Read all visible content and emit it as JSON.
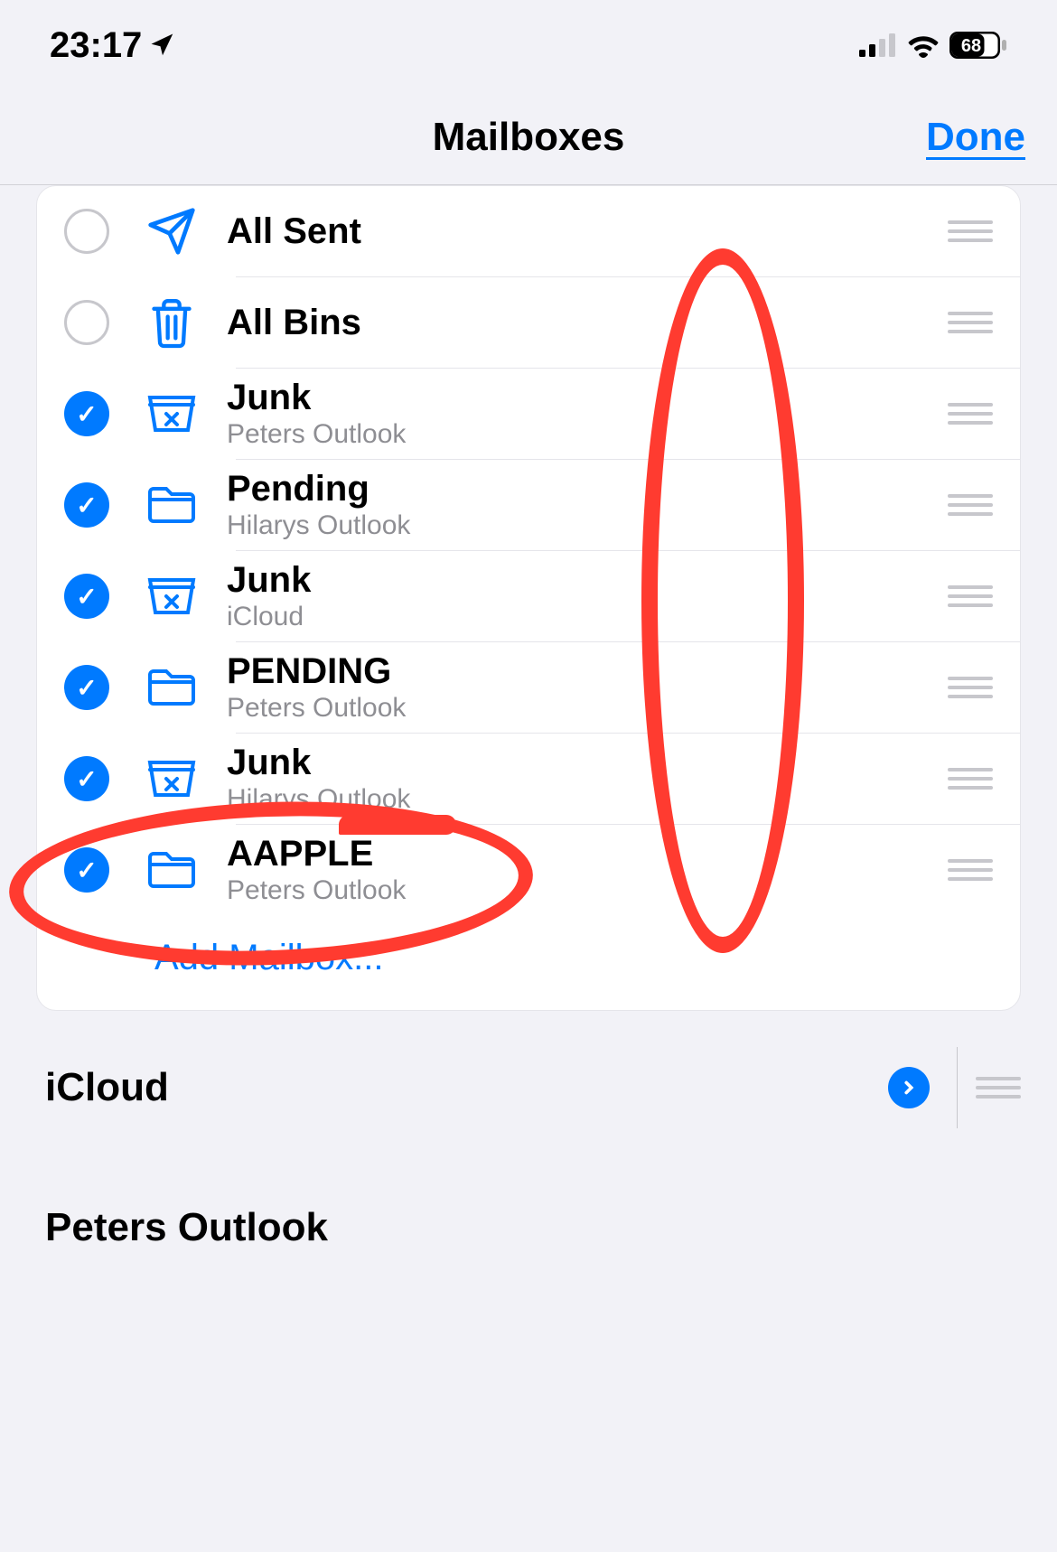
{
  "statusBar": {
    "time": "23:17",
    "battery": "68"
  },
  "nav": {
    "title": "Mailboxes",
    "done": "Done"
  },
  "mailboxes": [
    {
      "label": "All Sent",
      "sublabel": "",
      "checked": false,
      "icon": "send"
    },
    {
      "label": "All Bins",
      "sublabel": "",
      "checked": false,
      "icon": "trash"
    },
    {
      "label": "Junk",
      "sublabel": "Peters Outlook",
      "checked": true,
      "icon": "junk"
    },
    {
      "label": "Pending",
      "sublabel": "Hilarys Outlook",
      "checked": true,
      "icon": "folder"
    },
    {
      "label": "Junk",
      "sublabel": "iCloud",
      "checked": true,
      "icon": "junk"
    },
    {
      "label": "PENDING",
      "sublabel": "Peters Outlook",
      "checked": true,
      "icon": "folder"
    },
    {
      "label": "Junk",
      "sublabel": "Hilarys Outlook",
      "checked": true,
      "icon": "junk"
    },
    {
      "label": "AAPPLE",
      "sublabel": "Peters Outlook",
      "checked": true,
      "icon": "folder"
    }
  ],
  "addMailbox": "Add Mailbox...",
  "accounts": [
    {
      "name": "iCloud"
    },
    {
      "name": "Peters Outlook"
    }
  ]
}
